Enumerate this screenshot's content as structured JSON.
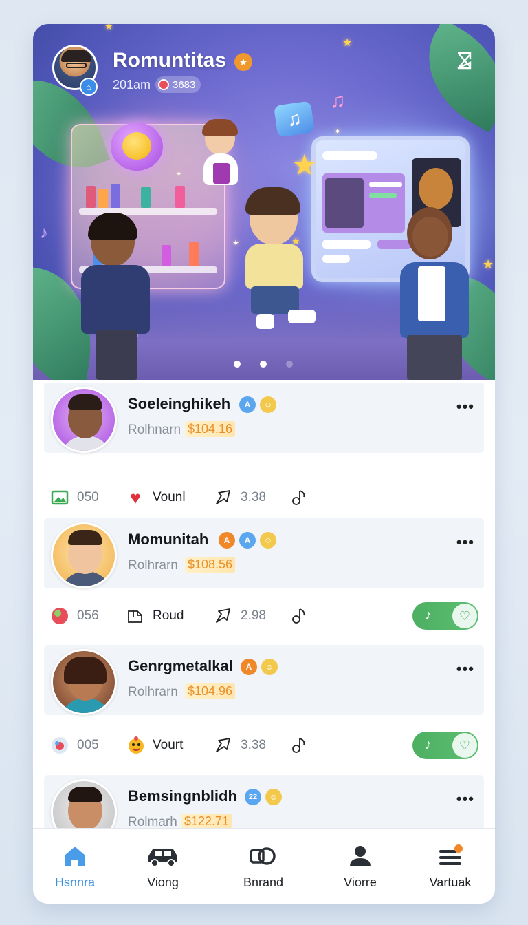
{
  "hero": {
    "title": "Romuntitas",
    "subtitle": "201am",
    "pill_text": "3683",
    "title_badge_icon": "star-icon",
    "close_icon": "exit-icon",
    "carousel_active_index": 1,
    "carousel_count": 3
  },
  "feed": [
    {
      "name": "Soeleinghikeh",
      "subtitle": "Rolhnarn",
      "price": "$104.16",
      "badges": [
        "blue",
        "yellow"
      ],
      "actions": {
        "count": "050",
        "like_label": "Vounl",
        "share_value": "3.38"
      },
      "toggle": false
    },
    {
      "name": "Momunitah",
      "subtitle": "Rolhrarn",
      "price": "$108.56",
      "badges": [
        "orange",
        "blue",
        "yellow"
      ],
      "actions": {
        "count": "056",
        "like_label": "Roud",
        "share_value": "2.98"
      },
      "toggle": true
    },
    {
      "name": "Genrgmetalkal",
      "subtitle": "Rolhrarn",
      "price": "$104.96",
      "badges": [
        "orange",
        "yellow"
      ],
      "actions": {
        "count": "005",
        "like_label": "Vourt",
        "share_value": "3.38"
      },
      "toggle": true
    },
    {
      "name": "Bemsingnblidh",
      "subtitle": "Rolmarh",
      "price": "$122.71",
      "badges": [
        "blue",
        "yellow"
      ],
      "badge_text": "22"
    }
  ],
  "nav": [
    {
      "label": "Hsnnra",
      "icon": "home-icon",
      "active": true
    },
    {
      "label": "Viong",
      "icon": "car-icon",
      "active": false
    },
    {
      "label": "Bnrand",
      "icon": "link-icon",
      "active": false
    },
    {
      "label": "Viorre",
      "icon": "person-icon",
      "active": false
    },
    {
      "label": "Vartuak",
      "icon": "menu-icon",
      "active": false
    }
  ],
  "colors": {
    "accent": "#3a8fe0",
    "toggle_on": "#4caf62",
    "price": "#e8902a"
  }
}
